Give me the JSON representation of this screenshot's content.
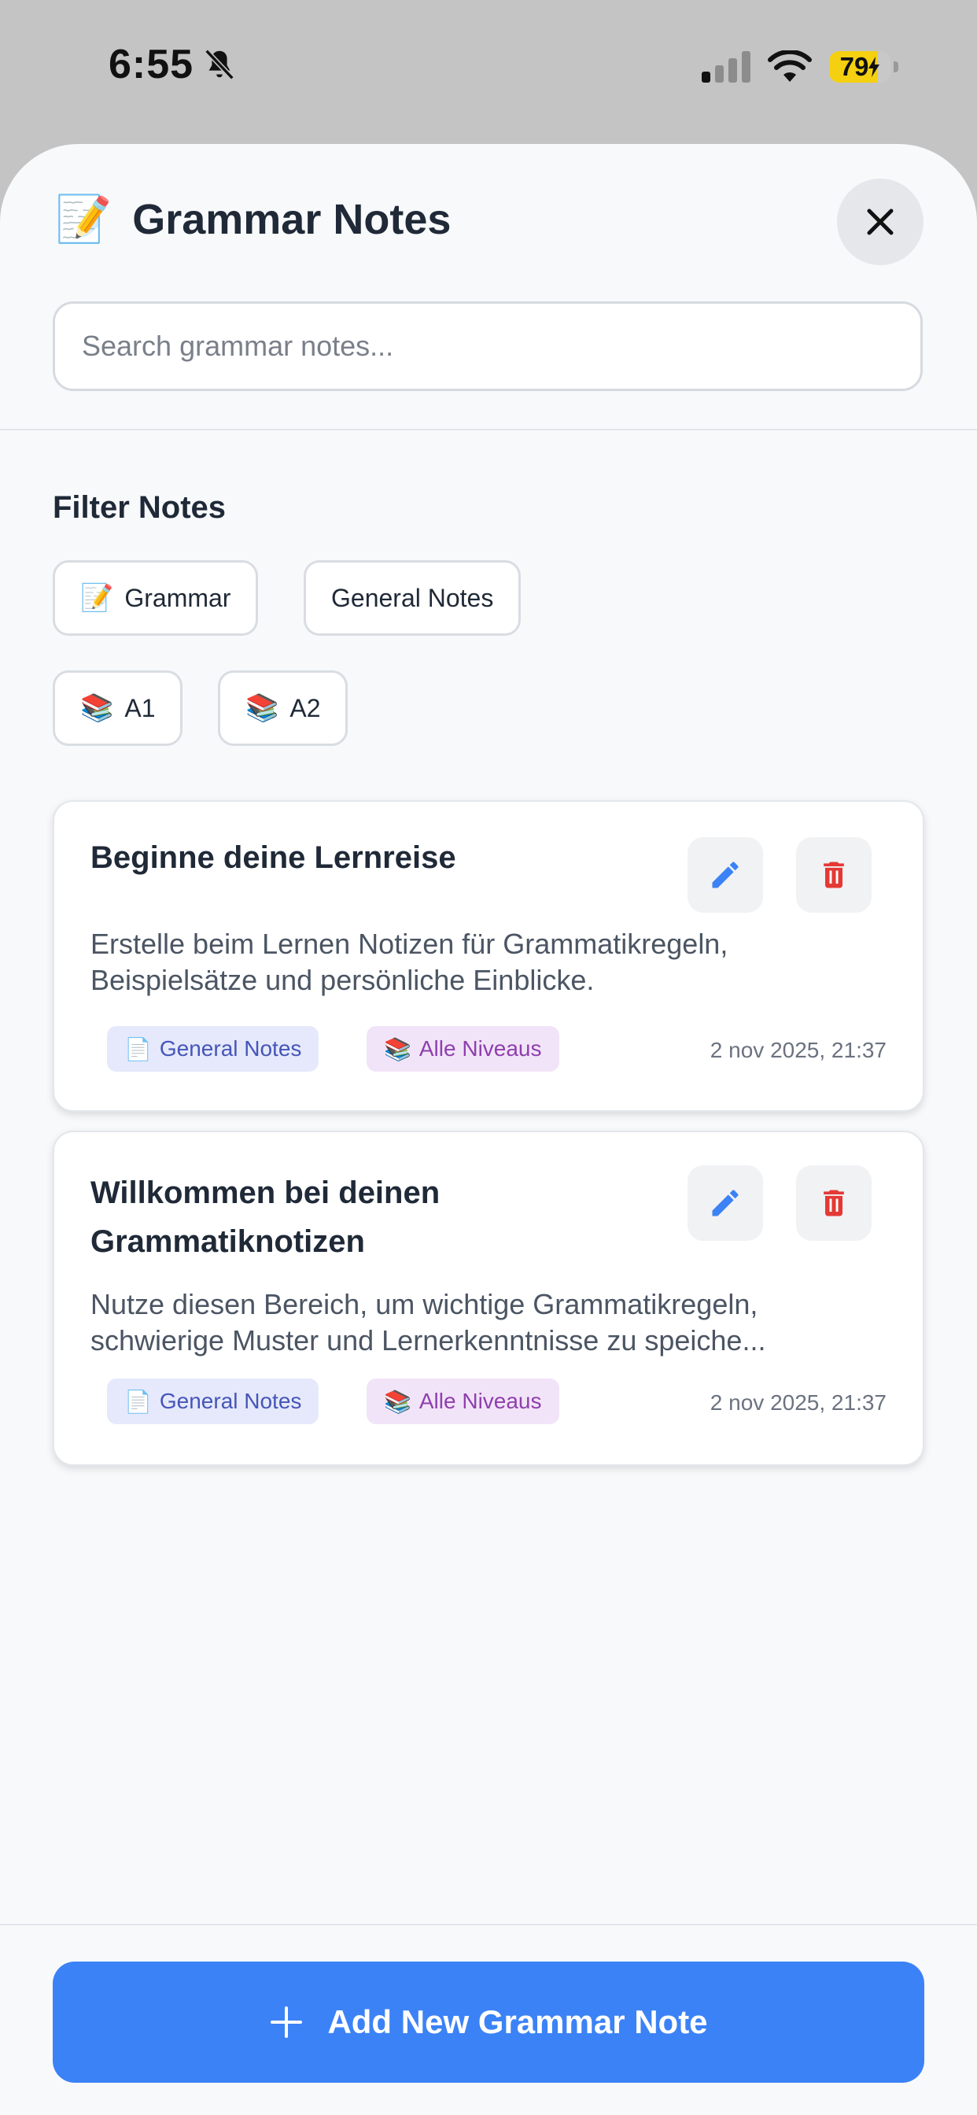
{
  "status_bar": {
    "time": "6:55",
    "battery_percent": "79",
    "battery_level": 0.79,
    "icons": [
      "bell-slash-icon",
      "signal-icon",
      "wifi-icon",
      "battery-charging-icon"
    ]
  },
  "header": {
    "emoji": "📝",
    "title": "Grammar Notes",
    "close_icon": "close-icon"
  },
  "search": {
    "placeholder": "Search grammar notes...",
    "value": ""
  },
  "filters": {
    "title": "Filter Notes",
    "chips": [
      {
        "emoji": "📝",
        "label": "Grammar"
      },
      {
        "emoji": "",
        "label": "General Notes"
      },
      {
        "emoji": "📚",
        "label": "A1"
      },
      {
        "emoji": "📚",
        "label": "A2"
      }
    ]
  },
  "notes": [
    {
      "title": "Beginne deine Lernreise",
      "body": "Erstelle beim Lernen Notizen für Grammatikregeln, Beispielsätze und persönliche Einblicke.",
      "tag_type": {
        "emoji": "📄",
        "label": "General Notes"
      },
      "tag_level": {
        "emoji": "📚",
        "label": "Alle Niveaus"
      },
      "date": "2 nov 2025, 21:37"
    },
    {
      "title": "Willkommen bei deinen Grammatiknotizen",
      "body": "Nutze diesen Bereich, um wichtige Grammatikregeln, schwierige Muster und Lernerkenntnisse zu speiche...",
      "tag_type": {
        "emoji": "📄",
        "label": "General Notes"
      },
      "tag_level": {
        "emoji": "📚",
        "label": "Alle Niveaus"
      },
      "date": "2 nov 2025, 21:37"
    }
  ],
  "footer": {
    "add_label": "Add New Grammar Note",
    "add_icon": "plus-icon"
  },
  "colors": {
    "accent": "#3b82f6",
    "edit_icon": "#3b82f6",
    "delete_icon": "#e53935",
    "battery": "#f5d010"
  }
}
